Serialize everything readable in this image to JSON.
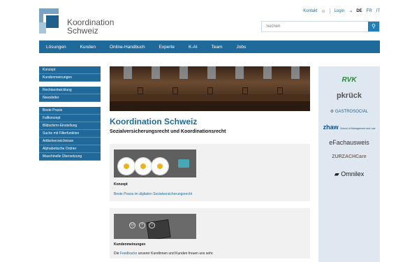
{
  "logo": {
    "line1": "Koordination",
    "line2": "Schweiz"
  },
  "toplinks": {
    "kontakt": "Kontakt",
    "login": "Login",
    "langs": [
      "DE",
      "FR",
      "IT"
    ],
    "active_lang": "DE"
  },
  "search": {
    "placeholder": "Suchen"
  },
  "mainnav": [
    "Lösungen",
    "Kunden",
    "Online-Handbuch",
    "Experte",
    "K-AI",
    "Team",
    "Jobs"
  ],
  "sidebar": {
    "group1": [
      "Konzept",
      "Kundenmeinungen"
    ],
    "group2": [
      "Rechtsentwicklung",
      "Newsletter"
    ],
    "group3": [
      "Beste Praxis",
      "Fallkonzept",
      "Bildschirm-Einstellung",
      "Suche mit Filterfunktion",
      "Artikelverzeichnisse",
      "Alphabetische Ordner",
      "Maschinelle Übersetzung"
    ]
  },
  "main": {
    "title": "Koordination Schweiz",
    "subtitle": "Sozialversicherungsrecht und Koordinationsrecht",
    "card1": {
      "title": "Konzept",
      "link": "Beste Praxis im digitalen Sozialversicherungsrecht"
    },
    "card2": {
      "title": "Kundenmeinungen",
      "text_pre": "Die ",
      "link": "Feedbacks",
      "text_post": " unserer Kundinnen und Kunden freuen uns sehr."
    }
  },
  "partners": {
    "rvk": "RVK",
    "pk": "pkrück",
    "gs": "GASTROSOCIAL",
    "zhaw": "zhaw",
    "zhaw_sub": "School of Management and Law",
    "ef": "eFachausweis",
    "zc": "ZURZACHCare",
    "om": "Omnilex"
  },
  "colors": {
    "brand": "#1f6a9a",
    "sidebar_bg": "#1f6a9a",
    "partner_bg": "#dfe8f0",
    "card_bg": "#f1f1f1"
  }
}
